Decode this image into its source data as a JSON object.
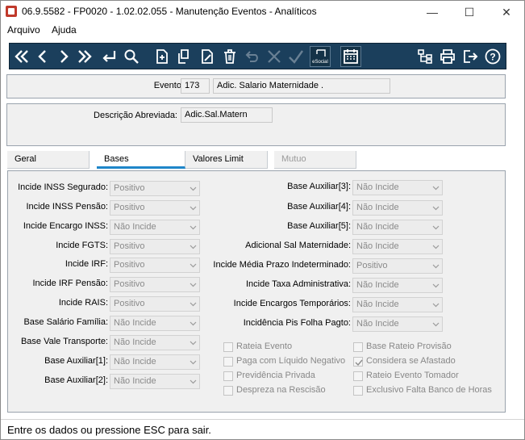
{
  "window": {
    "title": "06.9.5582 - FP0020 - 1.02.02.055 - Manutenção Eventos - Analíticos",
    "controls": [
      "—",
      "☐",
      "✕"
    ]
  },
  "menu": {
    "items": [
      "Arquivo",
      "Ajuda"
    ]
  },
  "toolbar": {
    "esocial_label": "eSocial",
    "buttons": [
      "first-icon",
      "previous-icon",
      "next-icon",
      "last-icon",
      "enter-icon",
      "search-icon",
      "new-record-icon",
      "copy-icon",
      "edit-icon",
      "delete-icon",
      "undo-icon",
      "cancel-icon",
      "confirm-icon",
      "esocial-icon",
      "calendar-icon",
      "tree-icon",
      "print-icon",
      "exit-icon",
      "help-icon"
    ]
  },
  "evento": {
    "label": "Evento:",
    "code": "173",
    "description": "Adic. Salario Maternidade  ."
  },
  "descricao": {
    "label": "Descrição Abreviada:",
    "value": "Adic.Sal.Matern"
  },
  "tabs": [
    {
      "label": "Geral"
    },
    {
      "label": "Bases"
    },
    {
      "label": "Valores Limit"
    },
    {
      "label": "Mutuo"
    }
  ],
  "left_fields": [
    {
      "label": "Incide INSS Segurado:",
      "value": "Positivo"
    },
    {
      "label": "Incide INSS Pensão:",
      "value": "Positivo"
    },
    {
      "label": "Incide Encargo INSS:",
      "value": "Não Incide"
    },
    {
      "label": "Incide FGTS:",
      "value": "Positivo"
    },
    {
      "label": "Incide IRF:",
      "value": "Positivo"
    },
    {
      "label": "Incide IRF Pensão:",
      "value": "Positivo"
    },
    {
      "label": "Incide RAIS:",
      "value": "Positivo"
    },
    {
      "label": "Base Salário Família:",
      "value": "Não Incide"
    },
    {
      "label": "Base Vale Transporte:",
      "value": "Não Incide"
    },
    {
      "label": "Base Auxiliar[1]:",
      "value": "Não Incide"
    },
    {
      "label": "Base Auxiliar[2]:",
      "value": "Não Incide"
    }
  ],
  "right_fields": [
    {
      "label": "Base Auxiliar[3]:",
      "value": "Não Incide"
    },
    {
      "label": "Base Auxiliar[4]:",
      "value": "Não Incide"
    },
    {
      "label": "Base Auxiliar[5]:",
      "value": "Não Incide"
    },
    {
      "label": "Adicional Sal Maternidade:",
      "value": "Não Incide"
    },
    {
      "label": "Incide Média Prazo Indeterminado:",
      "value": "Positivo"
    },
    {
      "label": "Incide Taxa Administrativa:",
      "value": "Não Incide"
    },
    {
      "label": "Incide Encargos Temporários:",
      "value": "Não Incide"
    },
    {
      "label": "Incidência Pis Folha Pagto:",
      "value": "Não Incide"
    }
  ],
  "checkboxes_left": [
    {
      "label": "Rateia Evento",
      "checked": false
    },
    {
      "label": "Paga com Líquido Negativo",
      "checked": false
    },
    {
      "label": "Previdência Privada",
      "checked": false
    },
    {
      "label": "Despreza na Rescisão",
      "checked": false
    }
  ],
  "checkboxes_right": [
    {
      "label": "Base Rateio Provisão",
      "checked": false
    },
    {
      "label": "Considera se Afastado",
      "checked": true
    },
    {
      "label": "Rateio Evento Tomador",
      "checked": false
    },
    {
      "label": "Exclusivo Falta Banco de Horas",
      "checked": false
    }
  ],
  "status": {
    "text": "Entre os dados ou pressione ESC para sair."
  },
  "colors": {
    "toolbar_bg": "#1b3f5c",
    "tab_active_underline": "#1f86c9"
  }
}
